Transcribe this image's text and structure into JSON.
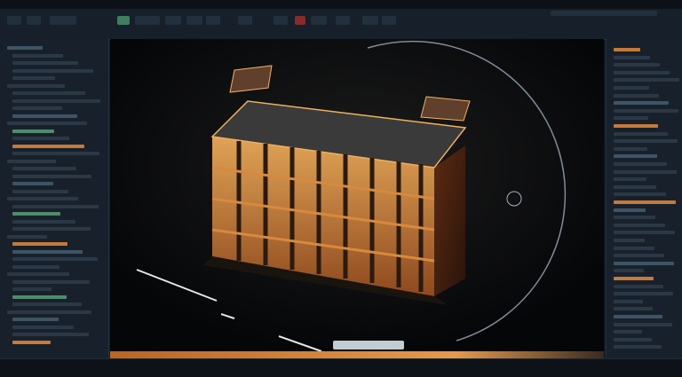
{
  "window": {
    "title": ""
  },
  "toolbar": {
    "buttons": [
      "",
      "",
      "",
      "",
      "",
      "",
      "",
      ""
    ]
  },
  "left_panel": {
    "rows": 40
  },
  "right_panel": {
    "rows": 40
  },
  "viewport": {
    "scene": "isometric-building-model"
  },
  "status_pill": {
    "text": ""
  },
  "colors": {
    "accent": "#e59a4e",
    "panel": "#18212b",
    "viewport": "#0a0d12"
  }
}
